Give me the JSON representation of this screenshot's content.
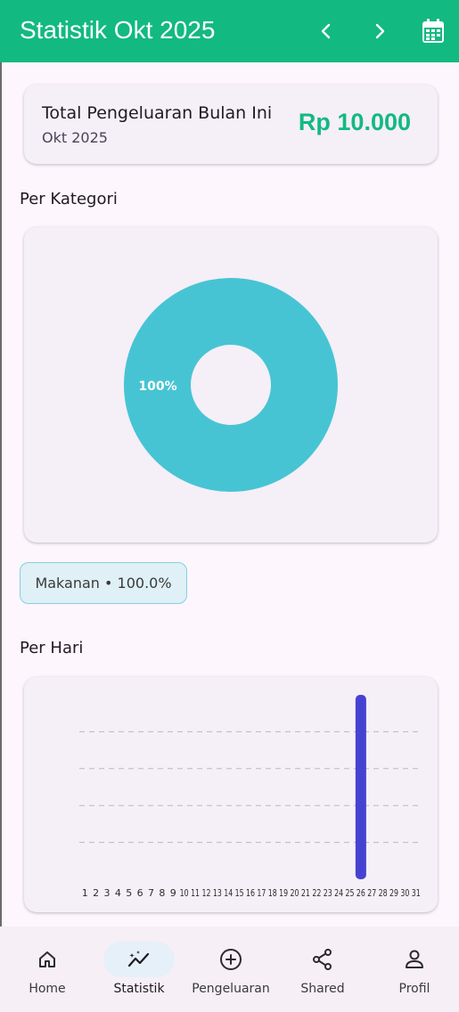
{
  "appbar": {
    "title": "Statistik Okt 2025",
    "prev_icon": "chevron-left-icon",
    "next_icon": "chevron-right-icon",
    "calendar_icon": "calendar-icon",
    "color": "#12b981"
  },
  "summary": {
    "label": "Total Pengeluaran Bulan Ini",
    "month": "Okt 2025",
    "amount": "Rp 10.000",
    "amount_color": "#12b981"
  },
  "sections": {
    "per_kategori": "Per Kategori",
    "per_hari": "Per Hari"
  },
  "legend": {
    "chip_label": "Makanan • 100.0%"
  },
  "chart_data": [
    {
      "type": "pie",
      "donut": true,
      "categories": [
        "Makanan"
      ],
      "values": [
        100
      ],
      "slice_labels": [
        "100%"
      ],
      "colors": [
        "#47c4d3"
      ]
    },
    {
      "type": "bar",
      "categories": [
        "1",
        "2",
        "3",
        "4",
        "5",
        "6",
        "7",
        "8",
        "9",
        "10",
        "11",
        "12",
        "13",
        "14",
        "15",
        "16",
        "17",
        "18",
        "19",
        "20",
        "21",
        "22",
        "23",
        "24",
        "25",
        "26",
        "27",
        "28",
        "29",
        "30",
        "31"
      ],
      "values": [
        0,
        0,
        0,
        0,
        0,
        0,
        0,
        0,
        0,
        0,
        0,
        0,
        0,
        0,
        0,
        0,
        0,
        0,
        0,
        0,
        0,
        0,
        0,
        0,
        0,
        10000,
        0,
        0,
        0,
        0,
        0
      ],
      "ylim": [
        0,
        10000
      ],
      "color": "#4542d1",
      "grid": "dashed-horizontal"
    }
  ],
  "nav": {
    "items": [
      {
        "label": "Home",
        "icon": "home-icon"
      },
      {
        "label": "Statistik",
        "icon": "chart-line-icon",
        "active": true
      },
      {
        "label": "Pengeluaran",
        "icon": "add-circle-icon"
      },
      {
        "label": "Shared",
        "icon": "share-icon"
      },
      {
        "label": "Profil",
        "icon": "person-icon"
      }
    ]
  }
}
